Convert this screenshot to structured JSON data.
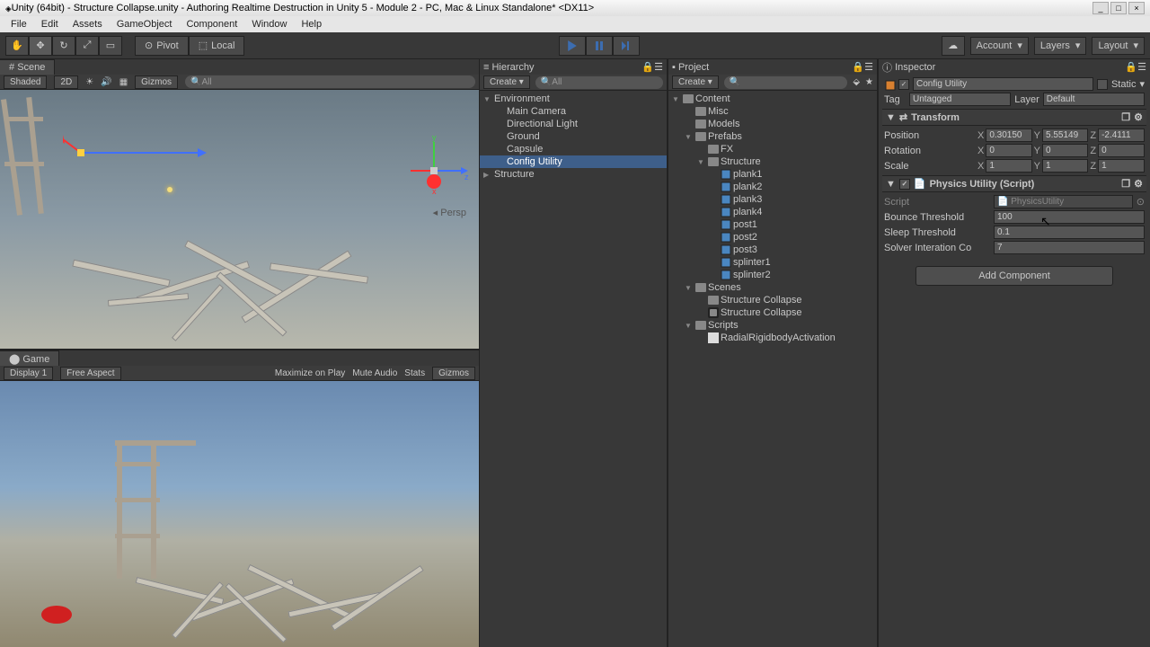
{
  "window": {
    "title": "Unity (64bit) - Structure Collapse.unity - Authoring Realtime Destruction in Unity 5 - Module 2 - PC, Mac & Linux Standalone* <DX11>"
  },
  "menu": {
    "items": [
      "File",
      "Edit",
      "Assets",
      "GameObject",
      "Component",
      "Window",
      "Help"
    ]
  },
  "toolbar": {
    "pivot": "Pivot",
    "local": "Local",
    "account": "Account",
    "layers": "Layers",
    "layout": "Layout"
  },
  "scene": {
    "tab": "Scene",
    "shaded": "Shaded",
    "mode_2d": "2D",
    "gizmos": "Gizmos",
    "search_all": "All",
    "persp": "Persp"
  },
  "game": {
    "tab": "Game",
    "display": "Display 1",
    "aspect": "Free Aspect",
    "max_on_play": "Maximize on Play",
    "mute": "Mute Audio",
    "stats": "Stats",
    "gizmos": "Gizmos"
  },
  "hierarchy": {
    "title": "Hierarchy",
    "create": "Create",
    "search_all": "All",
    "items": [
      {
        "label": "Environment",
        "expanded": true,
        "indent": 0
      },
      {
        "label": "Main Camera",
        "indent": 1
      },
      {
        "label": "Directional Light",
        "indent": 1
      },
      {
        "label": "Ground",
        "indent": 1
      },
      {
        "label": "Capsule",
        "indent": 1
      },
      {
        "label": "Config Utility",
        "indent": 1,
        "selected": true
      },
      {
        "label": "Structure",
        "expanded": false,
        "indent": 0
      }
    ]
  },
  "project": {
    "title": "Project",
    "create": "Create",
    "items": [
      {
        "label": "Content",
        "type": "folder",
        "indent": 0,
        "expanded": true
      },
      {
        "label": "Misc",
        "type": "folder",
        "indent": 1
      },
      {
        "label": "Models",
        "type": "folder",
        "indent": 1
      },
      {
        "label": "Prefabs",
        "type": "folder",
        "indent": 1,
        "expanded": true
      },
      {
        "label": "FX",
        "type": "folder",
        "indent": 2
      },
      {
        "label": "Structure",
        "type": "folder",
        "indent": 2,
        "expanded": true
      },
      {
        "label": "plank1",
        "type": "prefab",
        "indent": 3
      },
      {
        "label": "plank2",
        "type": "prefab",
        "indent": 3
      },
      {
        "label": "plank3",
        "type": "prefab",
        "indent": 3
      },
      {
        "label": "plank4",
        "type": "prefab",
        "indent": 3
      },
      {
        "label": "post1",
        "type": "prefab",
        "indent": 3
      },
      {
        "label": "post2",
        "type": "prefab",
        "indent": 3
      },
      {
        "label": "post3",
        "type": "prefab",
        "indent": 3
      },
      {
        "label": "splinter1",
        "type": "prefab",
        "indent": 3
      },
      {
        "label": "splinter2",
        "type": "prefab",
        "indent": 3
      },
      {
        "label": "Scenes",
        "type": "folder",
        "indent": 1,
        "expanded": true
      },
      {
        "label": "Structure Collapse",
        "type": "folder",
        "indent": 2
      },
      {
        "label": "Structure Collapse",
        "type": "scene",
        "indent": 2
      },
      {
        "label": "Scripts",
        "type": "folder",
        "indent": 1,
        "expanded": true
      },
      {
        "label": "RadialRigidbodyActivation",
        "type": "script",
        "indent": 2
      }
    ]
  },
  "inspector": {
    "title": "Inspector",
    "object_name": "Config Utility",
    "static_label": "Static",
    "tag_label": "Tag",
    "tag_value": "Untagged",
    "layer_label": "Layer",
    "layer_value": "Default",
    "transform": {
      "title": "Transform",
      "position_label": "Position",
      "rotation_label": "Rotation",
      "scale_label": "Scale",
      "pos": {
        "x": "0.30150",
        "y": "5.55149",
        "z": "-2.4111"
      },
      "rot": {
        "x": "0",
        "y": "0",
        "z": "0"
      },
      "scale": {
        "x": "1",
        "y": "1",
        "z": "1"
      }
    },
    "physics": {
      "title": "Physics Utility (Script)",
      "script_label": "Script",
      "script_value": "PhysicsUtility",
      "bounce_label": "Bounce Threshold",
      "bounce_value": "100",
      "sleep_label": "Sleep Threshold",
      "sleep_value": "0.1",
      "solver_label": "Solver Interation Co",
      "solver_value": "7"
    },
    "add_component": "Add Component"
  }
}
